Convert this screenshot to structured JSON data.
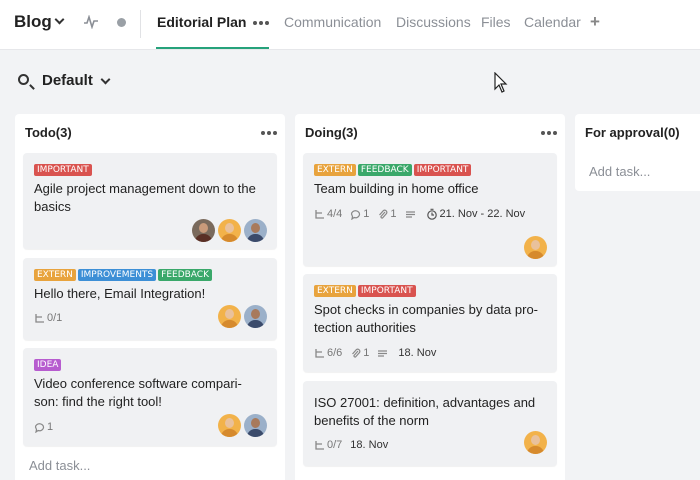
{
  "header": {
    "project_title": "Blog",
    "tabs": [
      {
        "label": "Editorial Plan"
      },
      {
        "label": "Communication"
      },
      {
        "label": "Discussions"
      },
      {
        "label": "Files"
      },
      {
        "label": "Calendar"
      }
    ],
    "add_tab": "+"
  },
  "filter": {
    "view": "Default"
  },
  "columns": [
    {
      "title": "Todo(3)",
      "add_task": "Add task...",
      "cards": [
        {
          "labels": [
            {
              "text": "IMPORTANT",
              "color": "#d9534f"
            }
          ],
          "title": "Agile project management down to the basics",
          "avatars": 3
        },
        {
          "labels": [
            {
              "text": "EXTERN",
              "color": "#e8a33d"
            },
            {
              "text": "IMPROVEMENTS",
              "color": "#3d8fd6"
            },
            {
              "text": "FEEDBACK",
              "color": "#3aa86a"
            }
          ],
          "title": "Hello there, Email Integration!",
          "subtasks": "0/1",
          "avatars": 2
        },
        {
          "labels": [
            {
              "text": "IDEA",
              "color": "#b75ccf"
            }
          ],
          "title": "Video conference software compari-son: find the right tool!",
          "comments": "1",
          "avatars": 2
        }
      ]
    },
    {
      "title": "Doing(3)",
      "cards": [
        {
          "labels": [
            {
              "text": "EXTERN",
              "color": "#e8a33d"
            },
            {
              "text": "FEEDBACK",
              "color": "#3aa86a"
            },
            {
              "text": "IMPORTANT",
              "color": "#d9534f"
            }
          ],
          "title": "Team building in home office",
          "subtasks": "4/4",
          "comments": "1",
          "attachments": "1",
          "date": "21. Nov - 22. Nov",
          "avatars": 1
        },
        {
          "labels": [
            {
              "text": "EXTERN",
              "color": "#e8a33d"
            },
            {
              "text": "IMPORTANT",
              "color": "#d9534f"
            }
          ],
          "title": "Spot checks in companies by data pro-tection authorities",
          "subtasks": "6/6",
          "attachments": "1",
          "date": "18. Nov"
        },
        {
          "title": "ISO 27001: definition, advantages and benefits of the norm",
          "subtasks": "0/7",
          "date": "18. Nov",
          "avatars": 1
        }
      ]
    },
    {
      "title": "For approval(0)",
      "add_task": "Add task..."
    }
  ],
  "colors": {
    "accent": "#26a27b",
    "background": "#f2f3f5"
  }
}
